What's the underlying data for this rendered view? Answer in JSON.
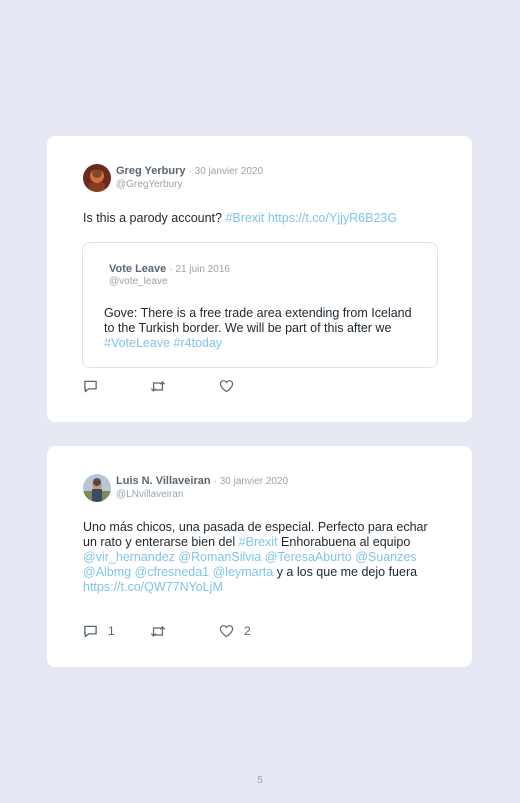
{
  "tweets": [
    {
      "author": "Greg Yerbury",
      "date": "· 30 janvier 2020",
      "handle": "@GregYerbury",
      "text_plain": "Is this a parody account? ",
      "hashtag": "#Brexit",
      "link": "https://t.co/YjjyR6B23G",
      "quote": {
        "author": "Vote Leave",
        "date": "· 21 juin 2016",
        "handle": "@vote_leave",
        "text_plain": "Gove: There is a free trade area extending from Iceland to the Turkish border. We will be part of this after we ",
        "hashtag1": "#VoteLeave",
        "hashtag2": "#r4today"
      }
    },
    {
      "author": "Luis N. Villaveiran",
      "date": "· 30 janvier 2020",
      "handle": "@LNvillaveiran",
      "text_part1": "Uno más chicos, una pasada de especial. Perfecto para echar un rato y enterarse bien del ",
      "hashtag": "#Brexit",
      "text_part2": " Enhorabuena al equipo ",
      "mentions": "@vir_hernandez @RomanSilvia @TeresaAburto @Suanzes @Albmg @cfresneda1 @leymarta",
      "text_part3": " y a los que me dejo fuera ",
      "link": "https://t.co/QW77NYoLjM",
      "reply_count": "1",
      "like_count": "2"
    }
  ],
  "icons": {
    "reply": "comment-icon",
    "retweet": "retweet-icon",
    "like": "heart-icon"
  },
  "colors": {
    "background": "#e6e8f3",
    "link": "#7fc4ea",
    "icon": "#5a6672"
  },
  "page_number": "5"
}
